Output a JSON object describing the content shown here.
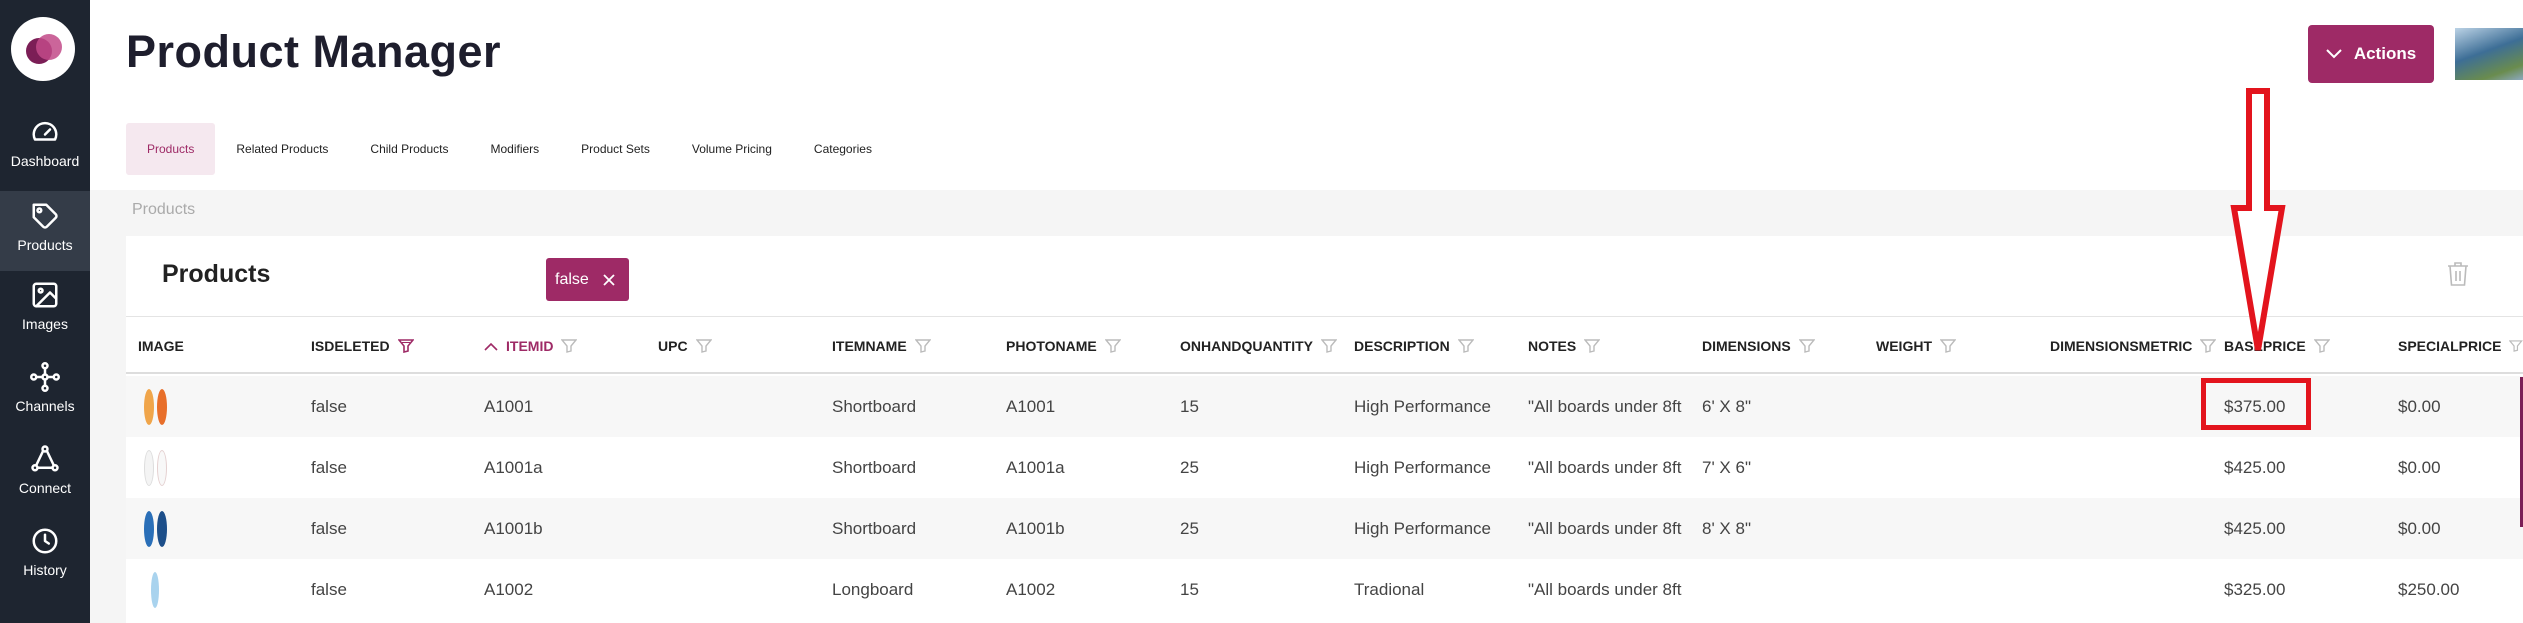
{
  "app": {
    "title": "Product Manager",
    "actions_label": "Actions",
    "accent_color": "#9e2a66",
    "sidebar_color": "#1e2530"
  },
  "sidebar": {
    "items": [
      {
        "label": "Dashboard",
        "icon": "gauge-icon"
      },
      {
        "label": "Products",
        "icon": "tag-icon",
        "active": true
      },
      {
        "label": "Images",
        "icon": "image-icon"
      },
      {
        "label": "Channels",
        "icon": "network-icon"
      },
      {
        "label": "Connect",
        "icon": "connect-icon"
      },
      {
        "label": "History",
        "icon": "clock-icon"
      }
    ]
  },
  "tabs": [
    {
      "label": "Products",
      "active": true
    },
    {
      "label": "Related Products"
    },
    {
      "label": "Child Products"
    },
    {
      "label": "Modifiers"
    },
    {
      "label": "Product Sets"
    },
    {
      "label": "Volume Pricing"
    },
    {
      "label": "Categories"
    }
  ],
  "breadcrumb": "Products",
  "panel": {
    "title": "Products",
    "filter_chip": "false"
  },
  "table": {
    "columns": [
      "IMAGE",
      "ISDELETED",
      "ITEMID",
      "UPC",
      "ITEMNAME",
      "PHOTONAME",
      "ONHANDQUANTITY",
      "DESCRIPTION",
      "NOTES",
      "DIMENSIONS",
      "WEIGHT",
      "DIMENSIONSMETRIC",
      "BASEPRICE",
      "SPECIALPRICE"
    ],
    "sorted_column": "ITEMID",
    "filtered_column": "ISDELETED",
    "rows": [
      {
        "isdeleted": "false",
        "itemid": "A1001",
        "upc": "",
        "itemname": "Shortboard",
        "photoname": "A1001",
        "onhand": "15",
        "description": "High Performance",
        "notes": "\"All boards under 8ft",
        "dimensions": "6' X 8\"",
        "weight": "",
        "dimensionsmetric": "",
        "baseprice": "$375.00",
        "specialprice": "$0.00"
      },
      {
        "isdeleted": "false",
        "itemid": "A1001a",
        "upc": "",
        "itemname": "Shortboard",
        "photoname": "A1001a",
        "onhand": "25",
        "description": "High Performance",
        "notes": "\"All boards under 8ft",
        "dimensions": "7' X 6\"",
        "weight": "",
        "dimensionsmetric": "",
        "baseprice": "$425.00",
        "specialprice": "$0.00"
      },
      {
        "isdeleted": "false",
        "itemid": "A1001b",
        "upc": "",
        "itemname": "Shortboard",
        "photoname": "A1001b",
        "onhand": "25",
        "description": "High Performance",
        "notes": "\"All boards under 8ft",
        "dimensions": "8' X 8\"",
        "weight": "",
        "dimensionsmetric": "",
        "baseprice": "$425.00",
        "specialprice": "$0.00"
      },
      {
        "isdeleted": "false",
        "itemid": "A1002",
        "upc": "",
        "itemname": "Longboard",
        "photoname": "A1002",
        "onhand": "15",
        "description": "Tradional",
        "notes": "\"All boards under 8ft",
        "dimensions": "",
        "weight": "",
        "dimensionsmetric": "",
        "baseprice": "$325.00",
        "specialprice": "$250.00"
      }
    ]
  },
  "annotation": {
    "highlight_color": "#e3141d"
  }
}
